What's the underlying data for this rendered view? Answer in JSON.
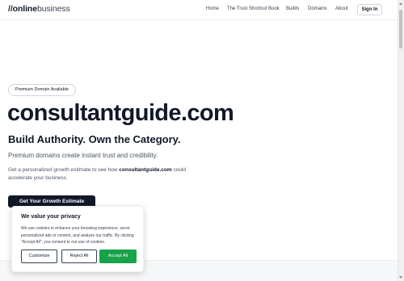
{
  "nav": {
    "logo_slashes": "//",
    "logo_part1": "online",
    "logo_part2": "business",
    "items": [
      {
        "label": "Home"
      },
      {
        "label": "The Trust Shortcut Book"
      },
      {
        "label": "Builds"
      },
      {
        "label": "Domains"
      },
      {
        "label": "About"
      }
    ],
    "signin": "Sign In"
  },
  "hero": {
    "badge": "Premium Domain Available",
    "domain": "consultantguide.com",
    "tagline": "Build Authority. Own the Category.",
    "subtext": "Premium domains create instant trust and credibility.",
    "desc_prefix": "Get a personalized growth estimate to see how ",
    "desc_domain": "consultantguide.com",
    "desc_suffix": " could accelerate your business.",
    "cta": "Get Your Growth Estimate"
  },
  "cookie": {
    "title": "We value your privacy",
    "text": "We use cookies to enhance your browsing experience, serve personalized ads or content, and analyze our traffic. By clicking \"Accept All\", you consent to our use of cookies.",
    "customize": "Customize",
    "reject": "Reject All",
    "accept": "Accept All"
  }
}
